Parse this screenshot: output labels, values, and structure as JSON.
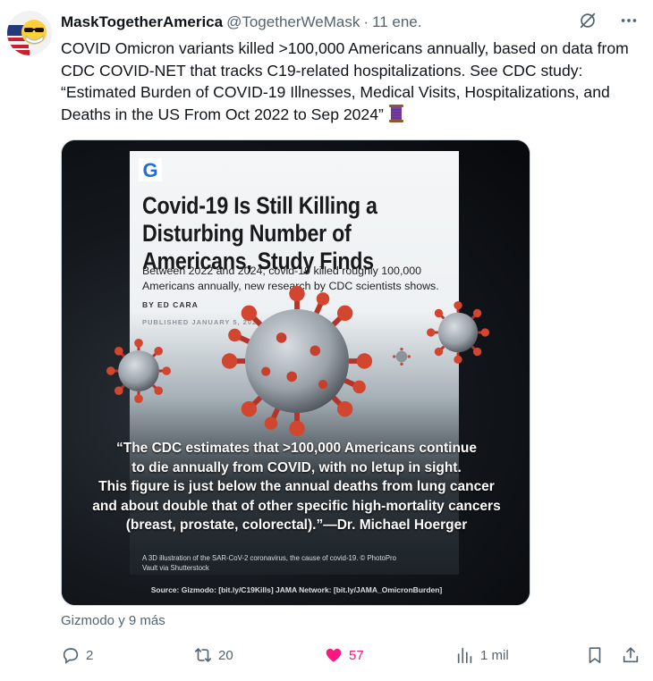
{
  "tweet": {
    "author_name": "MaskTogetherAmerica",
    "handle": "@TogetherWeMask",
    "separator": "·",
    "date": "11 ene.",
    "text": "COVID Omicron variants killed >100,000 Americans annually, based on data from CDC COVID-NET that tracks C19-related hospitalizations. See CDC study: “Estimated Burden of COVID-19 Illnesses, Medical Visits, Hospitalizations, and Deaths in the US From Oct 2022 to Sep 2024”",
    "thread_emoji": "thread-spool-icon"
  },
  "media": {
    "logo_letter": "G",
    "article_title": "Covid-19 Is Still Killing a Disturbing Number of Americans, Study Finds",
    "article_subtitle": "Between 2022 and 2024, covid-19 killed roughly 100,000 Americans annually, new research by CDC scientists shows.",
    "byline": "BY ED CARA",
    "published": "PUBLISHED JANUARY 5, 2026",
    "quote_lines": [
      "“The CDC estimates that >100,000 Americans continue",
      "to die annually from COVID, with no letup in sight.",
      "This figure is just below the annual deaths from lung cancer",
      "and about double that of other specific high-mortality cancers",
      "(breast, prostate, colorectal).”—Dr. Michael Hoerger"
    ],
    "caption": "A 3D illustration of the SAR-CoV-2 coronavirus, the cause of covid-19. © PhotoPro Vault via Shutterstock",
    "source": "Source: Gizmodo: [bit.ly/C19Kills]  JAMA Network: [bit.ly/JAMA_OmicronBurden]"
  },
  "attribution": "Gizmodo y 9 más",
  "actions": {
    "replies": "2",
    "reposts": "20",
    "likes": "57",
    "views": "1 mil"
  },
  "colors": {
    "like": "#f91880",
    "muted": "#536471",
    "text": "#0f1419"
  }
}
